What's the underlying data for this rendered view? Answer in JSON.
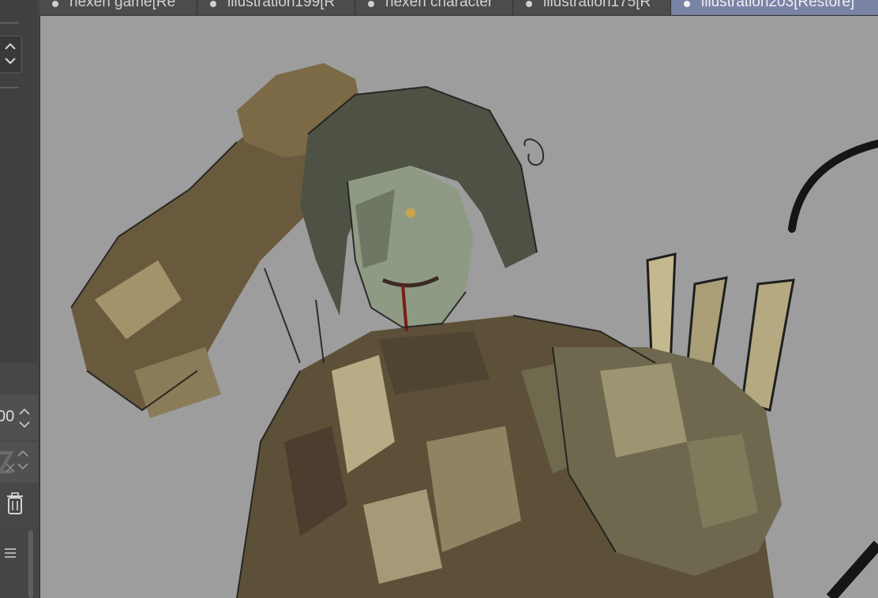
{
  "tabs": [
    {
      "label": "hexen game[Re",
      "active": false
    },
    {
      "label": "illustration199[R",
      "active": false
    },
    {
      "label": "hexen character",
      "active": false
    },
    {
      "label": "illustration175[R",
      "active": false
    },
    {
      "label": "illustration203[Restore]",
      "active": true
    }
  ],
  "left_panel": {
    "opacity_value": "00",
    "up_arrow": "⌃",
    "down_arrow": "⌄"
  },
  "icons": {
    "spin": "spin-arrows-icon",
    "opacity_spin": "spin-arrows-icon",
    "eraser": "eraser-icon",
    "trash": "trash-icon",
    "menu": "hamburger-menu-icon"
  },
  "colors": {
    "canvas_bg": "#9d9d9d",
    "active_tab": "#7b83a7",
    "panel_bg": "#464646"
  }
}
